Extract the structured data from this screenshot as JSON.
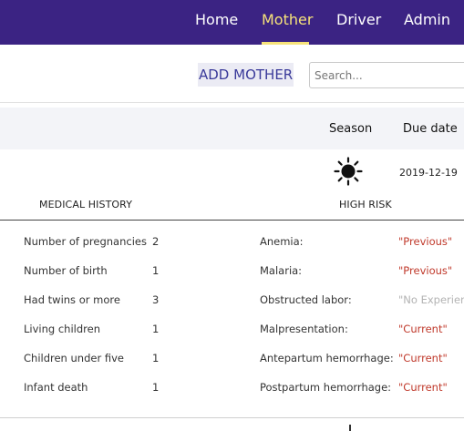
{
  "nav": {
    "items": [
      {
        "label": "Home",
        "active": false
      },
      {
        "label": "Mother",
        "active": true
      },
      {
        "label": "Driver",
        "active": false
      },
      {
        "label": "Admin",
        "active": false
      }
    ],
    "active_color": "#f6e27a",
    "background_color": "#3b2383"
  },
  "toolbar": {
    "add_label": "ADD MOTHER",
    "search_placeholder": "Search..."
  },
  "table": {
    "headers": {
      "season": "Season",
      "due_date": "Due date"
    },
    "row": {
      "season_icon": "sun-icon",
      "due_date": "2019-12-19"
    }
  },
  "medical_history": {
    "title": "MEDICAL HISTORY",
    "items": [
      {
        "label": "Number of pregnancies",
        "value": "2"
      },
      {
        "label": "Number of birth",
        "value": "1"
      },
      {
        "label": "Had twins or more",
        "value": "3"
      },
      {
        "label": "Living children",
        "value": "1"
      },
      {
        "label": "Children under five",
        "value": "1"
      },
      {
        "label": "Infant death",
        "value": "1"
      }
    ]
  },
  "high_risk": {
    "title": "HIGH RISK",
    "items": [
      {
        "label": "Anemia:",
        "status": "\"Previous\""
      },
      {
        "label": "Malaria:",
        "status": "\"Previous\""
      },
      {
        "label": "Obstructed labor:",
        "status": "\"No Experience\"",
        "muted": true
      },
      {
        "label": "Malpresentation:",
        "status": "\"Current\""
      },
      {
        "label": "Antepartum hemorrhage:",
        "status": "\"Current\""
      },
      {
        "label": "Postpartum hemorrhage:",
        "status": "\"Current\""
      }
    ],
    "status_color": "#c0392b",
    "muted_color": "#b3b3b3"
  }
}
